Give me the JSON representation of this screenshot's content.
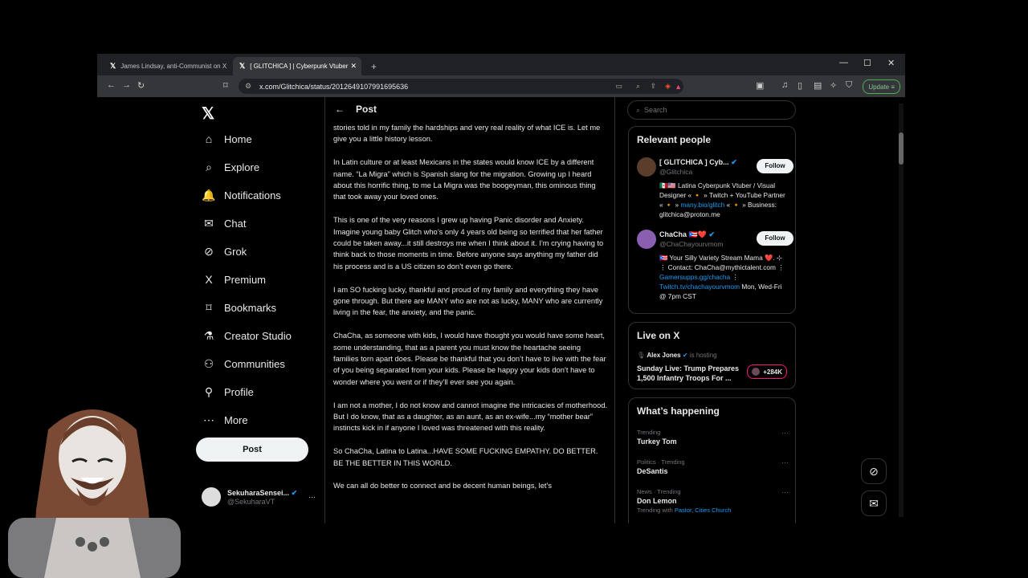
{
  "browser": {
    "tabs": [
      {
        "label": "James Lindsay, anti-Communist on X"
      },
      {
        "label": "[ GLITCHICA ] | Cyberpunk Vtuber"
      }
    ],
    "new_tab": "+",
    "url": "x.com/Glitchica/status/2012649107991695636",
    "update_label": "Update"
  },
  "nav": {
    "items": [
      {
        "label": "Home",
        "icon": "⌂"
      },
      {
        "label": "Explore",
        "icon": "⌕"
      },
      {
        "label": "Notifications",
        "icon": "🔔"
      },
      {
        "label": "Chat",
        "icon": "✉"
      },
      {
        "label": "Grok",
        "icon": "⊘"
      },
      {
        "label": "Premium",
        "icon": "X"
      },
      {
        "label": "Bookmarks",
        "icon": "⌑"
      },
      {
        "label": "Creator Studio",
        "icon": "⚗"
      },
      {
        "label": "Communities",
        "icon": "⚇"
      },
      {
        "label": "Profile",
        "icon": "⚲"
      },
      {
        "label": "More",
        "icon": "⋯"
      }
    ],
    "post_button": "Post",
    "user": {
      "name": "SekuharaSensei...",
      "handle": "@SekuharaVT"
    }
  },
  "center": {
    "title": "Post",
    "paragraphs": [
      "stories told in my family the hardships and very real reality of what ICE is. Let me give you a little history lesson.",
      "In Latin culture or at least Mexicans in the states would know ICE by a different name. “La Migra” which is Spanish slang for the migration. Growing up I heard about this horrific thing, to me La Migra was the boogeyman, this ominous thing that took away your loved ones.",
      "This is one of the very reasons I grew up having Panic disorder and Anxiety. Imagine young baby Glitch who’s only 4 years old being so terrified that her father could be taken away...it still destroys me when I think about it. I’m crying having to think back to those moments in time. Before anyone says anything my father did his process and is a US citizen so don’t even go there.",
      "I am SO fucking lucky, thankful and proud of my family and everything they have gone through. But there are MANY who are not as lucky, MANY who are currently living in the fear, the anxiety, and the panic.",
      "ChaCha, as someone with kids, I would have thought you would have some heart, some understanding, that as a parent you must know the heartache seeing families torn apart does. Please be thankful that you don’t have to live with the fear of you being separated from your kids. Please be happy your kids don’t have to wonder where you went or if they’ll ever see you again.",
      "I am not a mother, I do not know and cannot imagine the intricacies of motherhood. But I do know, that as a daughter, as an aunt, as an ex-wife...my “mother bear” instincts kick in if anyone I loved was threatened with this reality.",
      "So ChaCha, Latina to Latina...HAVE SOME FUCKING EMPATHY. DO BETTER. BE THE BETTER IN THIS WORLD.",
      "We can all do better to connect and be decent human beings, let’s"
    ]
  },
  "right": {
    "search_placeholder": "Search",
    "relevant": {
      "title": "Relevant people",
      "people": [
        {
          "name": "[ GLITCHICA ] Cyb...",
          "handle": "@Glitchica",
          "follow": "Follow",
          "bio": "🇲🇽🇺🇸 Latina Cyberpunk Vtuber / Visual Designer « 🔸 » Twitch + YouTube Partner « 🔸 » ",
          "bio_link": "many.bio/glitch",
          "bio_tail": " « 🔸 » Business: glitchica@proton.me"
        },
        {
          "name": "ChaCha 🇵🇷❤️",
          "handle": "@ChaChayourvmom",
          "follow": "Follow",
          "bio": "🇵🇷 Your Silly Variety Stream Mama ❤️. ⊹ ⋮ Contact: ChaCha@mythictalent.com ⋮ ",
          "bio_link": "Gamersupps.gg/chacha",
          "bio_mid": " ⋮ ",
          "bio_link2": "Twitch.tv/chachayourvmom",
          "bio_tail": " Mon, Wed-Fri @ 7pm CST"
        }
      ]
    },
    "live": {
      "title": "Live on X",
      "host": "Alex Jones",
      "hosting": "is hosting",
      "headline": "Sunday Live: Trump Prepares 1,500 Infantry Troops For ...",
      "count": "+284K"
    },
    "happening": {
      "title": "What’s happening",
      "trends": [
        {
          "context": "Trending",
          "name": "Turkey Tom",
          "extra": ""
        },
        {
          "context": "Politics · Trending",
          "name": "DeSantis",
          "extra": ""
        },
        {
          "context": "News · Trending",
          "name": "Don Lemon",
          "extra_prefix": "Trending with ",
          "extra": "Pastor, Cities Church"
        }
      ]
    }
  },
  "colors": {
    "accent": "#1d9bf0",
    "border": "#2f3336",
    "muted": "#71767b",
    "live": "#f91880"
  }
}
